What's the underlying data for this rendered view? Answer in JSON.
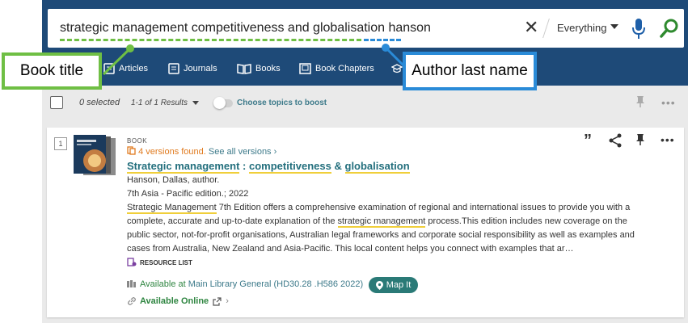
{
  "search": {
    "query": "strategic management competitiveness and globalisation hanson",
    "scope": "Everything"
  },
  "nav": {
    "tabs": [
      "Articles",
      "Journals",
      "Books",
      "Book Chapters"
    ]
  },
  "annotations": {
    "book_title": "Book title",
    "author_last_name": "Author last name"
  },
  "toolbar": {
    "selected": "0 selected",
    "result_count": "1-1 of 1 Results",
    "topics_label": "Choose topics to boost"
  },
  "result": {
    "index": "1",
    "type": "BOOK",
    "versions_found": "4 versions found.",
    "see_all": "See all versions",
    "title_part1": "Strategic management",
    "title_sep": " : ",
    "title_part2": "competitiveness",
    "title_amp": " & ",
    "title_part3": "globalisation",
    "author": "Hanson, Dallas, author.",
    "edition": "7th Asia - Pacific edition.; 2022",
    "desc_hl1": "Strategic Management",
    "desc_a": " 7th Edition offers a comprehensive examination of regional and international issues to provide you with a complete, accurate and up-to-date explanation of the ",
    "desc_hl2": "strategic management",
    "desc_b": " process.This edition includes new coverage on the public sector, not-for-profit organisations, Australian legal frameworks and corporate social responsibility as well as examples and cases from Australia, New Zealand and Asia-Pacific. This local content helps you connect with examples that ar…",
    "resource_list": "RESOURCE LIST",
    "available_at": "Available at",
    "location": "Main Library  General (HD30.28 .H586 2022)",
    "map_it": "Map It",
    "available_online": "Available Online"
  },
  "colors": {
    "header": "#1e4a78",
    "green_callout": "#6fbf44",
    "blue_callout": "#2a8bd8",
    "teal": "#236f7d",
    "available_green": "#2e8540",
    "highlight": "#f0cf3a"
  }
}
